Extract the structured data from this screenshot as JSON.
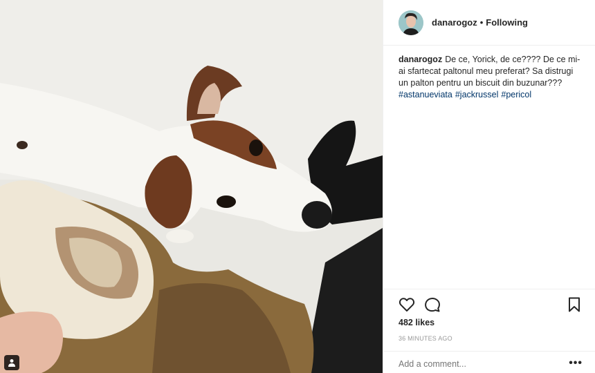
{
  "post": {
    "username": "danarogoz",
    "separator": "•",
    "follow_status": "Following",
    "caption_user": "danarogoz",
    "caption_text": "De ce, Yorick, de ce???? De ce mi-ai sfartecat paltonul meu preferat? Sa distrugi un palton pentru un biscuit din buzunar???",
    "hashtags": [
      "#astanueviata",
      "#jackrussel",
      "#pericol"
    ],
    "likes": "482 likes",
    "time": "36 MINUTES AGO",
    "comment_placeholder": "Add a comment...",
    "more_label": "•••"
  },
  "icons": {
    "like": "heart-icon",
    "comment": "comment-icon",
    "save": "bookmark-icon",
    "user_tag": "user-tag-icon"
  },
  "colors": {
    "hashtag": "#003569",
    "text": "#262626",
    "muted": "#999999",
    "border": "#efefef"
  }
}
